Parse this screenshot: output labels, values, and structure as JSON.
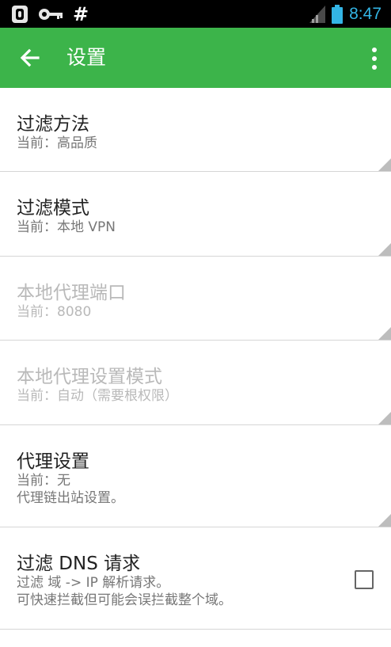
{
  "statusbar": {
    "time": "8:47",
    "left_icons": [
      "shield-icon",
      "key-icon",
      "hash-icon"
    ],
    "hash_symbol": "#"
  },
  "appbar": {
    "title": "设置"
  },
  "preferences": [
    {
      "title": "过滤方法",
      "summary": "当前：高品质",
      "enabled": true
    },
    {
      "title": "过滤模式",
      "summary": "当前：本地 VPN",
      "enabled": true
    },
    {
      "title": "本地代理端口",
      "summary": "当前：8080",
      "enabled": false
    },
    {
      "title": "本地代理设置模式",
      "summary": "当前：自动（需要根权限）",
      "enabled": false
    },
    {
      "title": "代理设置",
      "summary": "当前：无\n代理链出站设置。",
      "enabled": true
    },
    {
      "title": "过滤 DNS 请求",
      "summary": "过滤 域 -> IP 解析请求。\n可快速拦截但可能会误拦截整个域。",
      "enabled": true,
      "checked": false
    }
  ],
  "colors": {
    "appbar": "#3cb44a",
    "statusbar": "#000000",
    "clock": "#33b5e5"
  }
}
